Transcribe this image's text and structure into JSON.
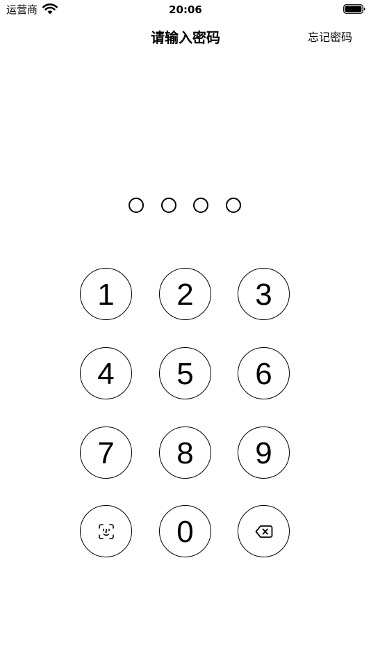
{
  "status_bar": {
    "carrier": "运营商",
    "time": "20:06"
  },
  "nav": {
    "title": "请输入密码",
    "forgot_label": "忘记密码"
  },
  "pin": {
    "length": 4,
    "filled": 0
  },
  "keypad": {
    "keys": [
      {
        "label": "1"
      },
      {
        "label": "2"
      },
      {
        "label": "3"
      },
      {
        "label": "4"
      },
      {
        "label": "5"
      },
      {
        "label": "6"
      },
      {
        "label": "7"
      },
      {
        "label": "8"
      },
      {
        "label": "9"
      },
      {
        "icon": "face-id-icon"
      },
      {
        "label": "0"
      },
      {
        "icon": "backspace-icon"
      }
    ]
  }
}
